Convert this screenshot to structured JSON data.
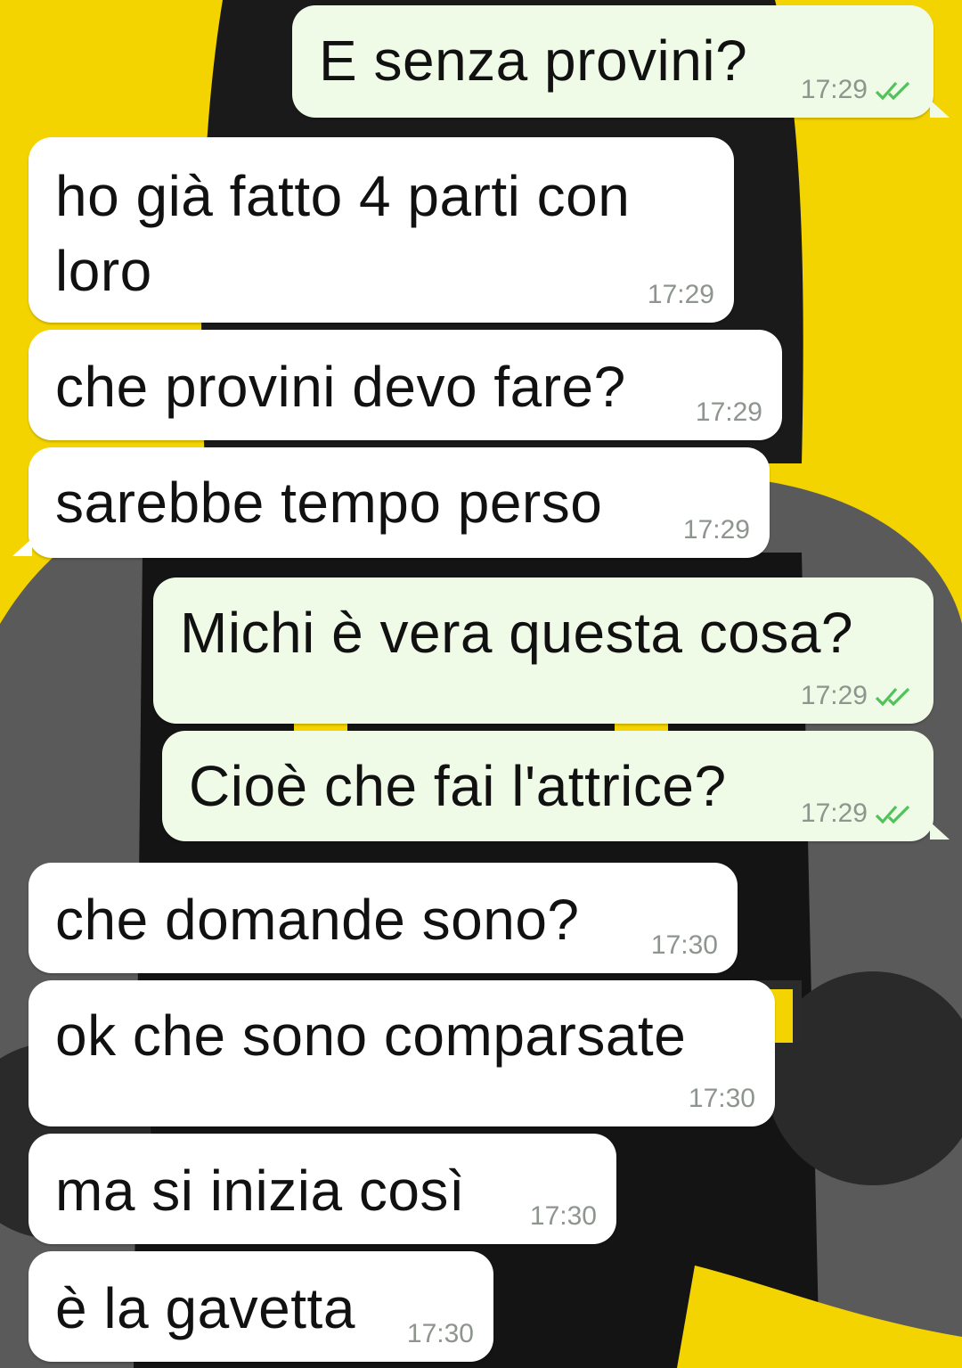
{
  "messages": [
    {
      "text": "E senza provini?",
      "time": "17:29",
      "direction": "out"
    },
    {
      "text": "ho già fatto 4 parti con\nloro",
      "time": "17:29",
      "direction": "in"
    },
    {
      "text": "che provini devo fare?",
      "time": "17:29",
      "direction": "in"
    },
    {
      "text": "sarebbe tempo perso",
      "time": "17:29",
      "direction": "in"
    },
    {
      "text": "Michi è vera questa cosa?",
      "time": "17:29",
      "direction": "out"
    },
    {
      "text": "Cioè che fai l'attrice?",
      "time": "17:29",
      "direction": "out"
    },
    {
      "text": "che domande sono?",
      "time": "17:30",
      "direction": "in"
    },
    {
      "text": "ok che sono comparsate",
      "time": "17:30",
      "direction": "in"
    },
    {
      "text": "ma si inizia così",
      "time": "17:30",
      "direction": "in"
    },
    {
      "text": "è la gavetta",
      "time": "17:30",
      "direction": "in"
    }
  ],
  "colors": {
    "wallpaper_yellow": "#f3d300",
    "incoming_bubble": "#ffffff",
    "outgoing_bubble": "#effbe6",
    "read_ticks": "#34b7f1",
    "timestamp": "#8e948e"
  },
  "icons": {
    "read_receipt": "double-check-icon"
  }
}
